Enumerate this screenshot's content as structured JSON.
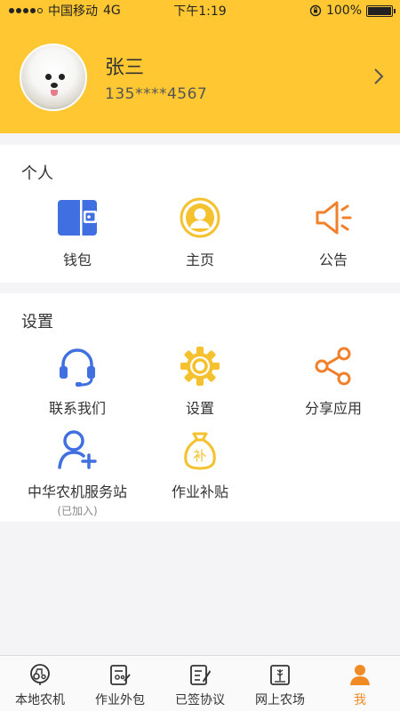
{
  "status_bar": {
    "carrier": "中国移动",
    "network": "4G",
    "time": "下午1:19",
    "battery": "100%"
  },
  "profile": {
    "name": "张三",
    "phone": "135****4567"
  },
  "personal_section": {
    "title": "个人",
    "items": [
      {
        "label": "钱包",
        "icon": "wallet-icon",
        "color": "#3f6fe0"
      },
      {
        "label": "主页",
        "icon": "user-home-icon",
        "color": "#f5c12e"
      },
      {
        "label": "公告",
        "icon": "megaphone-icon",
        "color": "#f0802a"
      }
    ]
  },
  "settings_section": {
    "title": "设置",
    "items": [
      {
        "label": "联系我们",
        "icon": "headset-icon",
        "color": "#3f6fe0"
      },
      {
        "label": "设置",
        "icon": "gear-icon",
        "color": "#f5c12e"
      },
      {
        "label": "分享应用",
        "icon": "share-icon",
        "color": "#f0802a"
      },
      {
        "label": "中华农机服务站",
        "sublabel": "(已加入)",
        "icon": "add-user-icon",
        "color": "#3f6fe0"
      },
      {
        "label": "作业补贴",
        "icon": "subsidy-bag-icon",
        "color": "#f5c12e",
        "badge": "补"
      }
    ]
  },
  "tab_bar": {
    "items": [
      {
        "label": "本地农机",
        "icon": "tractor-icon"
      },
      {
        "label": "作业外包",
        "icon": "outsource-icon"
      },
      {
        "label": "已签协议",
        "icon": "contract-icon"
      },
      {
        "label": "网上农场",
        "icon": "farm-icon"
      },
      {
        "label": "我",
        "icon": "me-icon",
        "active": true
      }
    ],
    "active_color": "#f08a24"
  },
  "colors": {
    "header_yellow": "#ffc832",
    "blue": "#3f6fe0",
    "yellow": "#f5c12e",
    "orange": "#f0802a"
  }
}
